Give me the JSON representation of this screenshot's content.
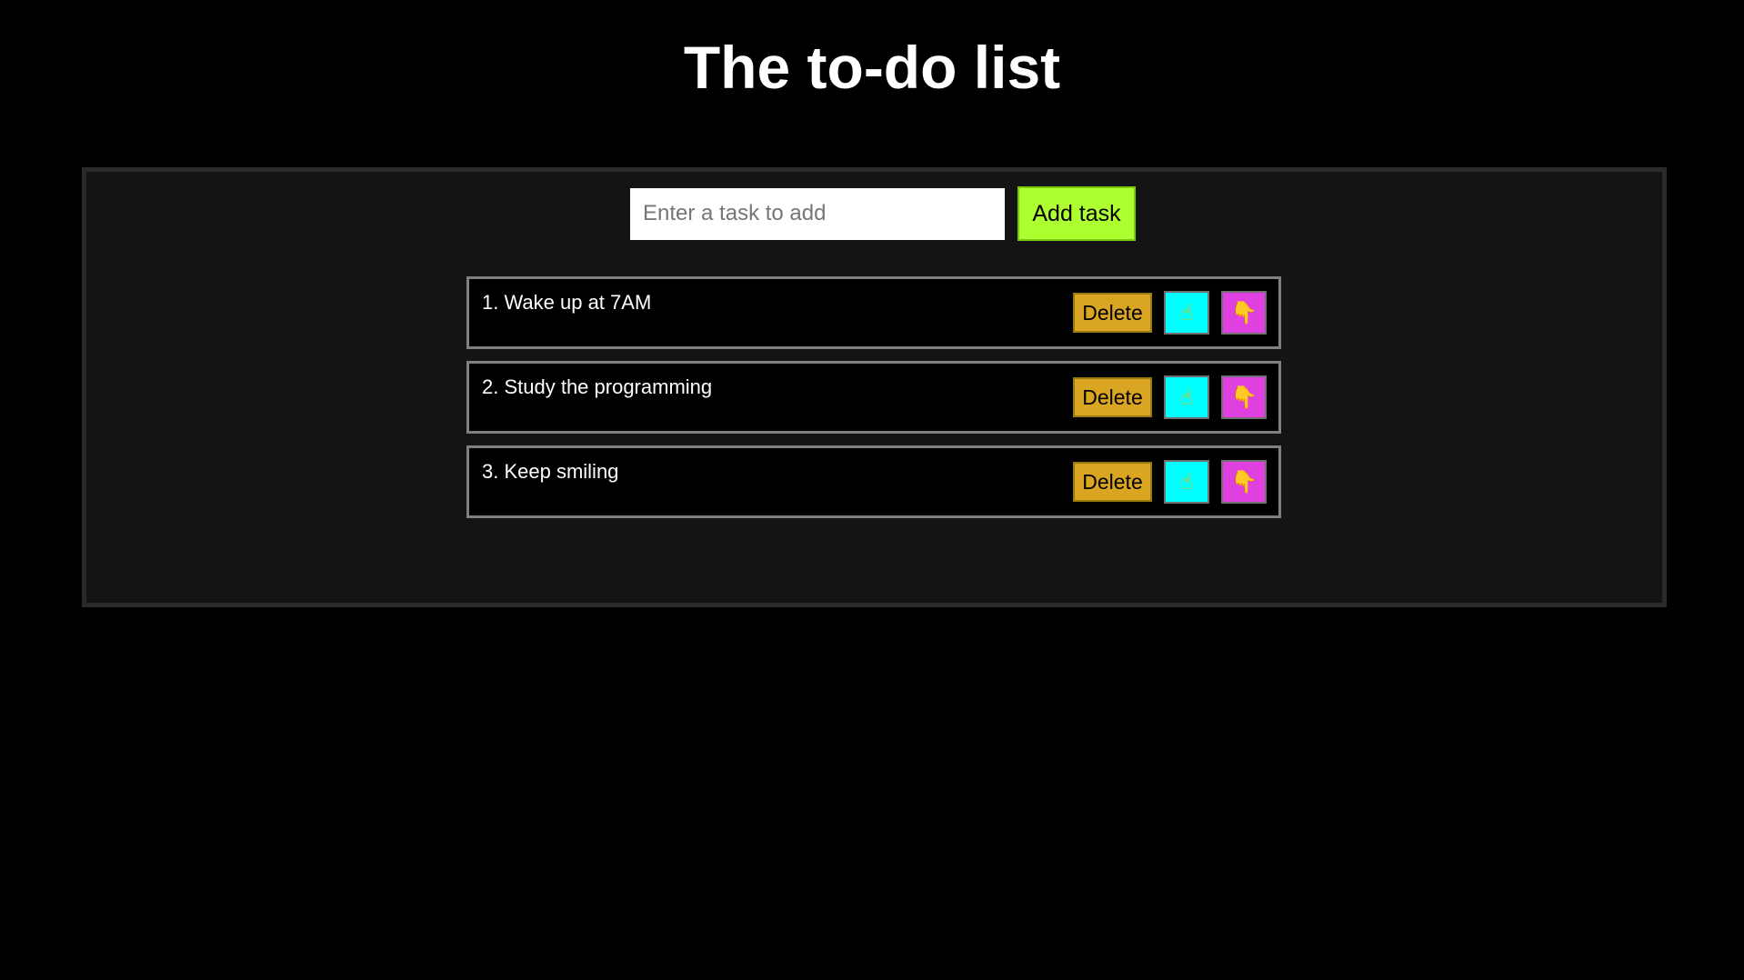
{
  "header": {
    "title": "The to-do list"
  },
  "add_form": {
    "placeholder": "Enter a task to add",
    "value": "",
    "add_label": "Add task"
  },
  "tasks": [
    {
      "label": "1. Wake up at 7AM",
      "delete_label": "Delete",
      "up_icon": "☝",
      "down_icon": "👇"
    },
    {
      "label": "2. Study the programming",
      "delete_label": "Delete",
      "up_icon": "☝",
      "down_icon": "👇"
    },
    {
      "label": "3. Keep smiling",
      "delete_label": "Delete",
      "up_icon": "☝",
      "down_icon": "👇"
    }
  ],
  "colors": {
    "background": "#000000",
    "panel": "#141414",
    "add_button": "#adff2f",
    "delete_button": "#daa520",
    "move_up_button": "#00ffff",
    "move_down_button": "#e040e0"
  },
  "icons": {
    "move_up": "pointing-up-hand-icon",
    "move_down": "pointing-down-hand-icon"
  }
}
